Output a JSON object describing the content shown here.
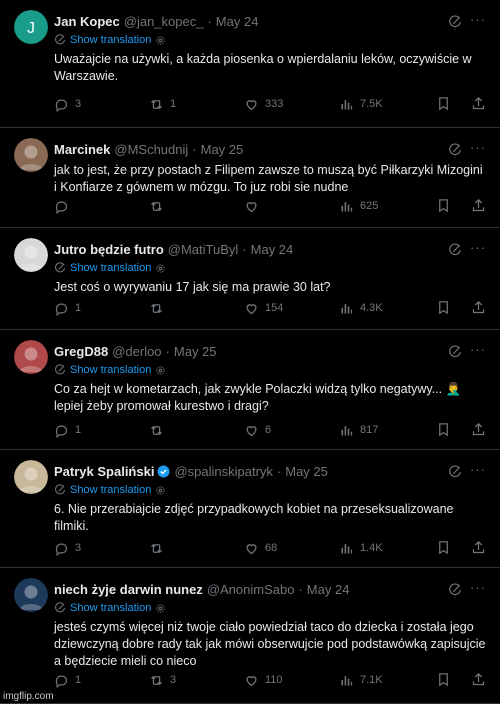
{
  "tweets": [
    {
      "name": "Jan Kopec",
      "handle": "@jan_kopec_",
      "date": "May 24",
      "verified": false,
      "translation": "Show translation",
      "text": "Uważajcie na używki, a każda piosenka o wpierdalaniu leków, oczywiście w Warszawie.",
      "replies": "3",
      "reposts": "1",
      "likes": "333",
      "views": "7.5K",
      "avatar": {
        "type": "letter",
        "letter": "J",
        "color": "#1a9c8a"
      }
    },
    {
      "name": "Marcinek",
      "handle": "@MSchudnij",
      "date": "May 25",
      "verified": false,
      "translation": "",
      "text": "jak to jest, że przy postach z Filipem zawsze to muszą być Piłkarzyki Mizogini i Konfiarze z gównem w mózgu. To juz robi sie nudne",
      "replies": "",
      "reposts": "",
      "likes": "",
      "views": "625",
      "avatar": {
        "type": "photo",
        "color": "#8a6a55"
      }
    },
    {
      "name": "Jutro będzie futro",
      "handle": "@MatiTuByl",
      "date": "May 24",
      "verified": false,
      "translation": "Show translation",
      "text": "Jest coś o wyrywaniu 17 jak się ma prawie 30 lat?",
      "replies": "1",
      "reposts": "",
      "likes": "154",
      "views": "4.3K",
      "avatar": {
        "type": "photo",
        "color": "#d8d8d8"
      }
    },
    {
      "name": "GregD88",
      "handle": "@derloo",
      "date": "May 25",
      "verified": false,
      "translation": "Show translation",
      "text": "Co za hejt w kometarzach, jak zwykle Polaczki widzą tylko negatywy... 🤦‍♂️ lepiej żeby promował kurestwo i dragi?",
      "replies": "1",
      "reposts": "",
      "likes": "6",
      "views": "817",
      "avatar": {
        "type": "photo",
        "color": "#b04a4a"
      }
    },
    {
      "name": "Patryk Spaliński",
      "handle": "@spalinskipatryk",
      "date": "May 25",
      "verified": true,
      "translation": "Show translation",
      "text": "6. Nie przerabiajcie zdjęć przypadkowych kobiet na przeseksualizowane filmiki.",
      "replies": "3",
      "reposts": "",
      "likes": "68",
      "views": "1.4K",
      "avatar": {
        "type": "photo",
        "color": "#c9b79a"
      }
    },
    {
      "name": "niech żyje darwin nunez",
      "handle": "@AnonimSabo",
      "date": "May 24",
      "verified": false,
      "translation": "Show translation",
      "text": "jesteś czymś więcej niż twoje ciało powiedział taco do dziecka i została jego dziewczyną dobre rady tak jak mówi obserwujcie pod podstawówką zapisujcie a będziecie mieli co nieco",
      "replies": "1",
      "reposts": "3",
      "likes": "110",
      "views": "7.1K",
      "avatar": {
        "type": "photo",
        "color": "#1e3a5a"
      }
    }
  ],
  "watermark": "imgflip.com",
  "colors": {
    "background": "#000000",
    "text": "#e7e9ea",
    "muted": "#71767b",
    "link": "#1d9bf0",
    "border": "#2f3336",
    "verified": "#1d9bf0"
  },
  "icons": [
    "reply-icon",
    "repost-icon",
    "like-icon",
    "views-icon",
    "bookmark-icon",
    "share-icon",
    "grok-icon",
    "more-icon",
    "translate-icon",
    "gear-icon",
    "verified-icon"
  ]
}
